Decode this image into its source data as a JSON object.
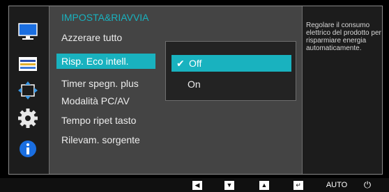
{
  "menu": {
    "title": "IMPOSTA&RIAVVIA",
    "items": [
      {
        "label": "Azzerare tutto"
      },
      {
        "label": "Risp. Eco intell."
      },
      {
        "label": "Timer spegn. plus"
      },
      {
        "label": "Modalità PC/AV"
      },
      {
        "label": "Tempo ripet tasto"
      },
      {
        "label": "Rilevam. sorgente"
      }
    ],
    "selected_index": 1
  },
  "dropdown": {
    "options": [
      {
        "label": "Off",
        "checked": true
      },
      {
        "label": "On",
        "checked": false
      }
    ]
  },
  "help_text": "Regolare il consumo elettrico del prodotto per risparmiare energia automaticamente.",
  "sidebar": {
    "icons": [
      "picture-icon",
      "onscreen-display-icon",
      "position-icon",
      "system-gear-icon",
      "information-icon"
    ],
    "active_icon": "system-gear-icon"
  },
  "bottom_bar": {
    "left_glyph": "◀",
    "down_glyph": "▼",
    "up_glyph": "▲",
    "enter_glyph": "↵",
    "auto_label": "AUTO",
    "power_glyph": "⏻"
  },
  "colors": {
    "accent": "#19b2bf",
    "panel": "#444444",
    "background": "#1c1c1c"
  }
}
